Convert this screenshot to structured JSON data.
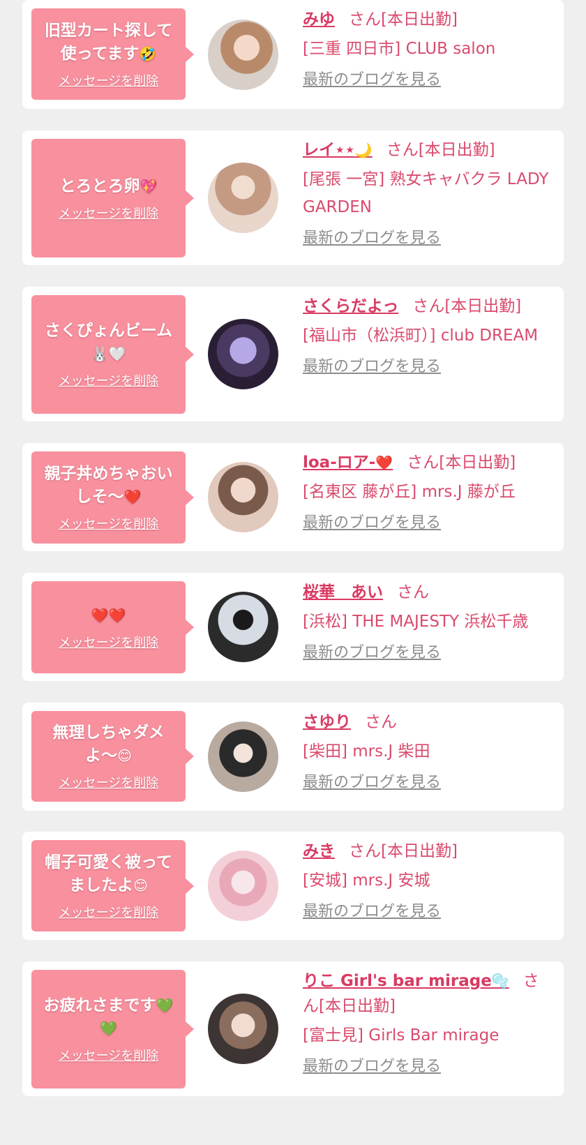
{
  "delete_label": "メッセージを削除",
  "blog_label": "最新のブログを見る",
  "colors": {
    "background": "#efefef",
    "card": "#ffffff",
    "bubble": "#f8909e",
    "name": "#d93a62",
    "text": "#d94a6c",
    "link_gray": "#8c8c8c"
  },
  "cards": [
    {
      "message": "旧型カート探して使ってます",
      "message_emoji": "🤣",
      "name": "みゆ",
      "name_emoji": "",
      "san": "さん[本日出勤]",
      "shop": "[三重 四日市] CLUB salon",
      "avatar_icon": "woman-portrait-icon"
    },
    {
      "message": "とろとろ卵",
      "message_emoji": "💖",
      "name": "レイ⋆⋆",
      "name_emoji": "🌙",
      "san": "さん[本日出勤]",
      "shop": "[尾張 一宮] 熟女キャバクラ LADY GARDEN",
      "avatar_icon": "woman-portrait-icon"
    },
    {
      "message": "さくぴょんビーム",
      "message_emoji": "🐰🤍",
      "name": "さくらだよっ",
      "name_emoji": "",
      "san": "さん[本日出勤]",
      "shop": "[福山市（松浜町）] club DREAM",
      "avatar_icon": "woman-portrait-icon"
    },
    {
      "message": "親子丼めちゃおいしそ〜",
      "message_emoji": "❤️",
      "name": "loa-ロア-",
      "name_emoji": "❤️",
      "san": "さん[本日出勤]",
      "shop": "[名東区 藤が丘] mrs.J 藤が丘",
      "avatar_icon": "woman-portrait-icon"
    },
    {
      "message": "",
      "message_emoji": "❤️❤️",
      "name": "桜華　あい",
      "name_emoji": "",
      "san": "さん",
      "shop": "[浜松] THE MAJESTY 浜松千歳",
      "avatar_icon": "woman-portrait-icon"
    },
    {
      "message": "無理しちゃダメよ〜",
      "message_emoji": "😊",
      "name": "さゆり",
      "name_emoji": "",
      "san": "さん",
      "shop": "[柴田] mrs.J 柴田",
      "avatar_icon": "woman-portrait-icon"
    },
    {
      "message": "帽子可愛く被ってましたよ",
      "message_emoji": "😊",
      "name": "みき",
      "name_emoji": "",
      "san": "さん[本日出勤]",
      "shop": "[安城] mrs.J 安城",
      "avatar_icon": "woman-portrait-icon"
    },
    {
      "message": "お疲れさまです",
      "message_emoji": "💚💚",
      "name": "りこ Girl's bar mirage",
      "name_emoji": "🫧",
      "san": "さん[本日出勤]",
      "shop": "[富士見] Girls Bar mirage",
      "avatar_icon": "woman-portrait-icon"
    }
  ]
}
